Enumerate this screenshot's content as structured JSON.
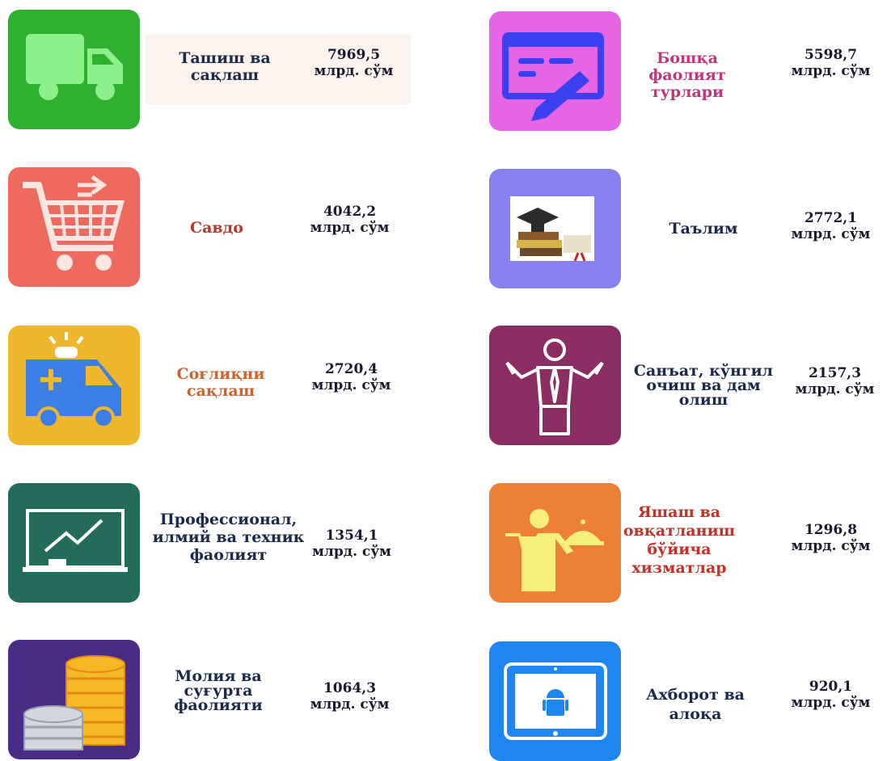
{
  "sectors": [
    {
      "label": "Ташиш ва сақлаш",
      "value": "7969,5",
      "unit": "млрд. сўм",
      "label_color": "#1a2a4a",
      "tile_color": "#2fb031",
      "icon": "truck-icon"
    },
    {
      "label": "Бошқа фаолият турлари",
      "value": "5598,7",
      "unit": "млрд. сўм",
      "label_color": "#c0357e",
      "tile_color": "#e665e6",
      "icon": "form-pen-icon"
    },
    {
      "label": "Савдо",
      "value": "4042,2",
      "unit": "млрд. сўм",
      "label_color": "#b5382b",
      "tile_color": "#ee6a5e",
      "icon": "shopping-cart-icon"
    },
    {
      "label": "Таълим",
      "value": "2772,1",
      "unit": "млрд. сўм",
      "label_color": "#1a2a4a",
      "tile_color": "#8781ef",
      "icon": "books-graduation-icon"
    },
    {
      "label": "Соғлиқни сақлаш",
      "value": "2720,4",
      "unit": "млрд. сўм",
      "label_color": "#c9652c",
      "tile_color": "#f0b72d",
      "icon": "ambulance-icon"
    },
    {
      "label": "Санъат, кўнгил очиш ва дам олиш",
      "value": "2157,3",
      "unit": "млрд. сўм",
      "label_color": "#1a2a4a",
      "tile_color": "#8b2c62",
      "icon": "performer-icon"
    },
    {
      "label": "Профессионал, илмий ва техник фаолият",
      "value": "1354,1",
      "unit": "млрд. сўм",
      "label_color": "#1a2a4a",
      "tile_color": "#236c5c",
      "icon": "presentation-board-icon"
    },
    {
      "label": "Яшаш ва овқатланиш бўйича хизматлар",
      "value": "1296,8",
      "unit": "млрд. сўм",
      "label_color": "#c13328",
      "tile_color": "#ee7f36",
      "icon": "waiter-icon"
    },
    {
      "label": "Молия ва суғурта фаолияти",
      "value": "1064,3",
      "unit": "млрд. сўм",
      "label_color": "#1a2a4a",
      "tile_color": "#4a2c86",
      "icon": "coins-icon"
    },
    {
      "label": "Ахборот ва алоқа",
      "value": "920,1",
      "unit": "млрд. сўм",
      "label_color": "#1a2a4a",
      "tile_color": "#1f86ef",
      "icon": "tablet-android-icon"
    }
  ]
}
